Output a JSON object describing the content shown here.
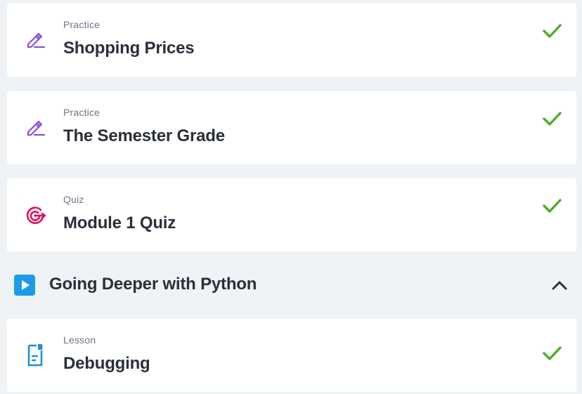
{
  "items": [
    {
      "type": "Practice",
      "title": "Shopping Prices",
      "icon": "pencil-practice-icon",
      "status": "completed"
    },
    {
      "type": "Practice",
      "title": "The Semester Grade",
      "icon": "pencil-practice-icon",
      "status": "completed"
    },
    {
      "type": "Quiz",
      "title": "Module 1 Quiz",
      "icon": "target-quiz-icon",
      "status": "completed"
    }
  ],
  "section": {
    "title": "Going Deeper with Python",
    "icon": "play-icon",
    "expanded": true
  },
  "section_items": [
    {
      "type": "Lesson",
      "title": "Debugging",
      "icon": "document-lesson-icon",
      "status": "completed"
    }
  ],
  "colors": {
    "background": "#f0f3f6",
    "card": "#ffffff",
    "check": "#4caf23",
    "practice_icon": "#8a4fd8",
    "quiz_icon": "#e0105c",
    "lesson_icon": "#1e8fe0",
    "section_icon": "#1e9be8",
    "text_primary": "#2a2f3a",
    "text_secondary": "#6b7686"
  }
}
